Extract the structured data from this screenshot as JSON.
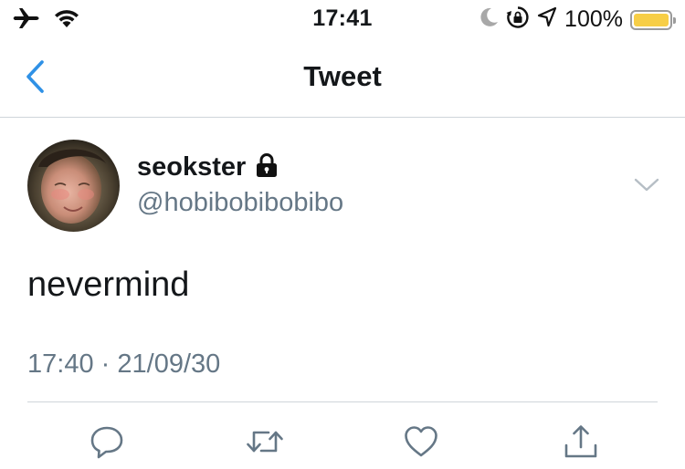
{
  "status_bar": {
    "time": "17:41",
    "battery_percent": "100%",
    "battery_level": 1.0,
    "battery_color": "#f7ce46",
    "icons": [
      "airplane-icon",
      "wifi-icon",
      "moon-icon",
      "rotation-lock-icon",
      "location-icon",
      "battery-icon"
    ]
  },
  "nav": {
    "title": "Tweet",
    "back_icon": "chevron-left-icon",
    "accent": "#2f91e6"
  },
  "tweet": {
    "display_name": "seokster",
    "protected_icon": "lock-icon",
    "handle": "@hobibobibobibo",
    "text": "nevermind",
    "time": "17:40",
    "separator": "·",
    "date": "21/09/30",
    "menu_icon": "chevron-down-icon"
  },
  "actions": [
    {
      "name": "reply-button",
      "icon": "reply-icon"
    },
    {
      "name": "retweet-button",
      "icon": "retweet-icon"
    },
    {
      "name": "like-button",
      "icon": "heart-icon"
    },
    {
      "name": "share-button",
      "icon": "share-icon"
    }
  ],
  "colors": {
    "text": "#14171a",
    "secondary": "#657786",
    "divider": "#cfd5da",
    "icon_gray": "#657786"
  }
}
